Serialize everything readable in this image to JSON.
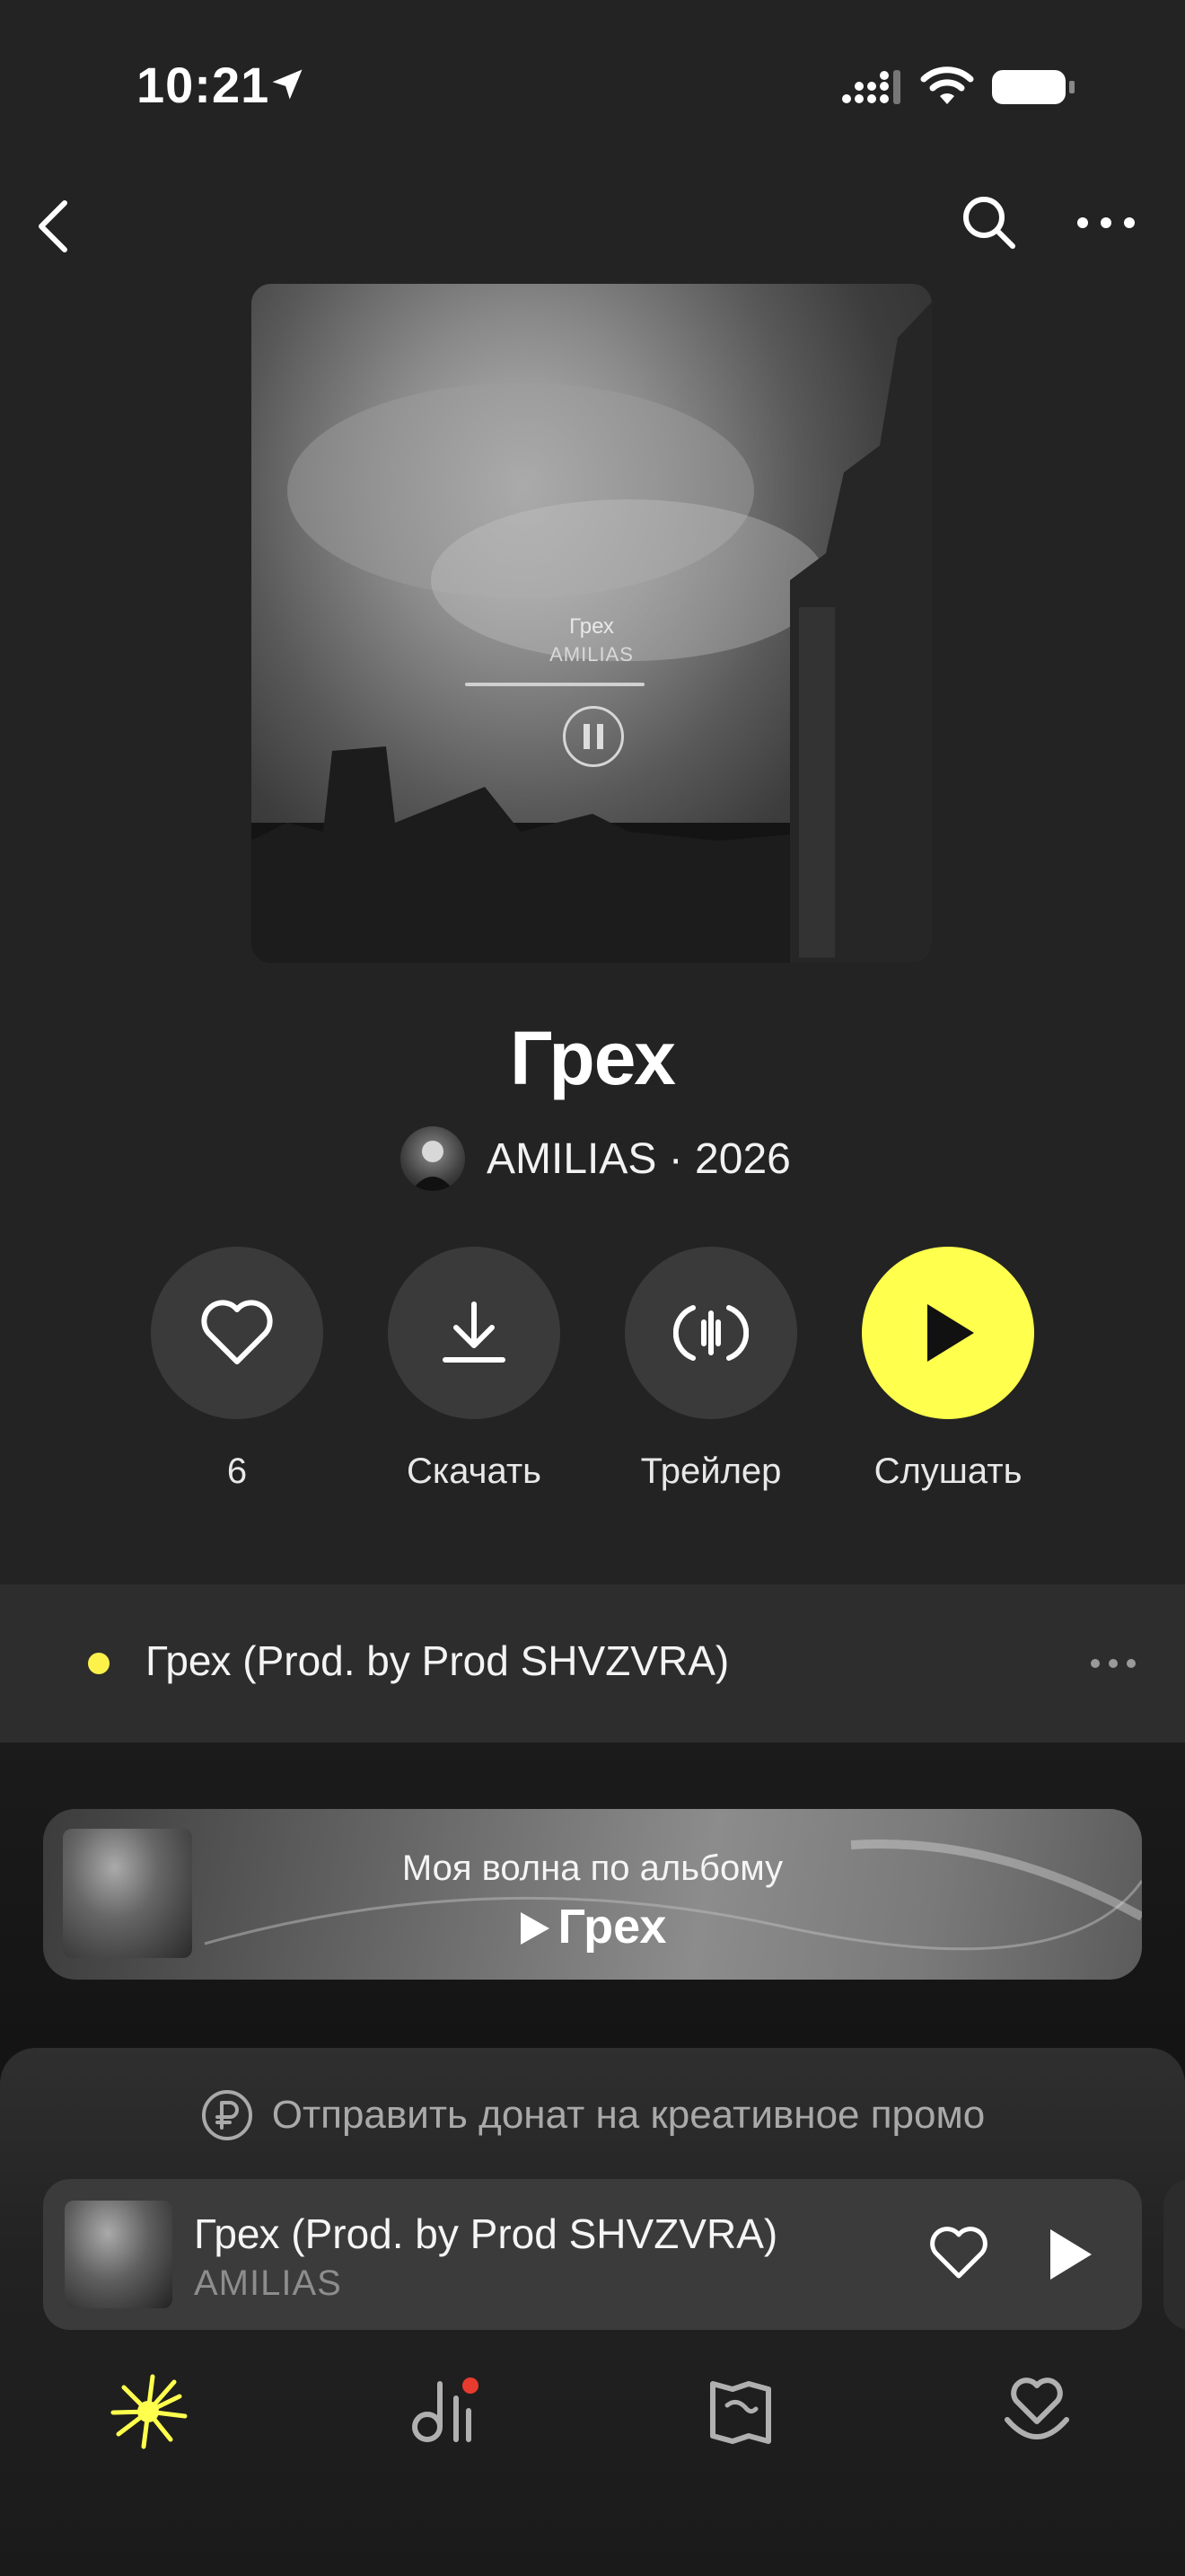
{
  "status_bar": {
    "time": "10:21"
  },
  "album": {
    "title": "Грех",
    "artist_line": "AMILIAS · 2026"
  },
  "cover": {
    "track": "Грех",
    "artist": "AMILIAS"
  },
  "actions": [
    {
      "icon": "heart-icon",
      "label": "6"
    },
    {
      "icon": "download-icon",
      "label": "Скачать"
    },
    {
      "icon": "trailer-icon",
      "label": "Трейлер"
    },
    {
      "icon": "play-icon",
      "label": "Слушать"
    }
  ],
  "track_list": [
    {
      "title": "Грех (Prod. by Prod SHVZVRA)"
    }
  ],
  "wave_card": {
    "subtitle": "Моя волна по альбому",
    "title": "Грех"
  },
  "donate": {
    "text": "Отправить донат на креативное промо"
  },
  "mini_player": {
    "title": "Грех (Prod. by Prod SHVZVRA)",
    "artist": "AMILIAS"
  },
  "tabs": [
    {
      "icon": "wave-star-icon",
      "active": true
    },
    {
      "icon": "collection-icon",
      "badge": true
    },
    {
      "icon": "map-icon"
    },
    {
      "icon": "kids-heart-icon"
    }
  ],
  "colors": {
    "accent": "#ffff4d",
    "background": "#232323",
    "badge": "#e63b2e"
  }
}
